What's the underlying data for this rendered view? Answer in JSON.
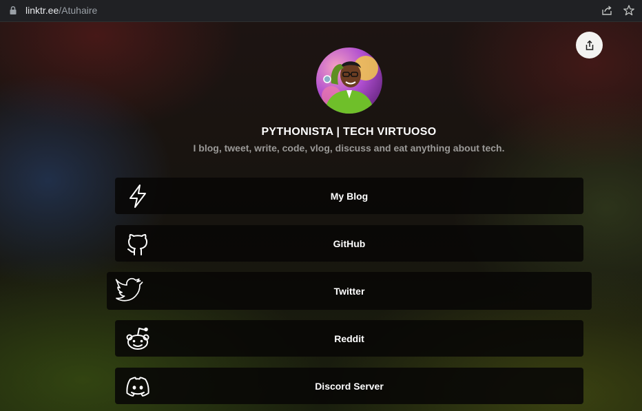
{
  "browser": {
    "url_host": "linktr.ee",
    "url_path": "/Atuhaire"
  },
  "profile": {
    "name": "PYTHONISTA | TECH VIRTUOSO",
    "bio": "I blog, tweet, write, code, vlog, discuss and eat anything about tech."
  },
  "links": [
    {
      "label": "My Blog",
      "icon": "lightning-icon"
    },
    {
      "label": "GitHub",
      "icon": "github-icon"
    },
    {
      "label": "Twitter",
      "icon": "twitter-icon"
    },
    {
      "label": "Reddit",
      "icon": "reddit-icon"
    },
    {
      "label": "Discord Server",
      "icon": "discord-icon"
    }
  ],
  "colors": {
    "link_bg": "#080706",
    "link_text": "#ffffff",
    "bio_text": "#9b9a98",
    "share_button_bg": "#f3f3f1"
  }
}
